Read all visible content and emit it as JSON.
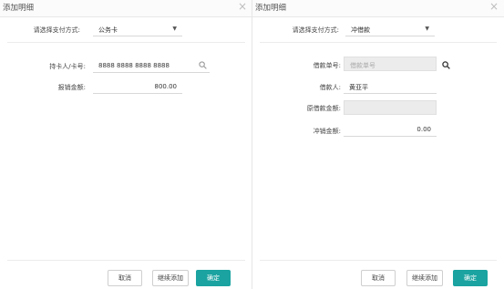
{
  "left": {
    "title": "添加明细",
    "pay_label": "请选择支付方式:",
    "pay_value": "公务卡",
    "card_label": "持卡人/卡号:",
    "card_value": "8888 8888 8888 8888",
    "amount_label": "报销金额:",
    "amount_value": "800.00",
    "buttons": {
      "cancel": "取消",
      "continue": "继续添加",
      "confirm": "确定"
    }
  },
  "right": {
    "title": "添加明细",
    "pay_label": "请选择支付方式:",
    "pay_value": "冲借款",
    "loan_no_label": "借款单号:",
    "loan_no_placeholder": "借款单号",
    "borrower_label": "借款人:",
    "borrower_value": "黄亚平",
    "orig_amount_label": "原借款金额:",
    "orig_amount_value": "",
    "offset_label": "冲销金额:",
    "offset_value": "0.00",
    "buttons": {
      "cancel": "取消",
      "continue": "继续添加",
      "confirm": "确定"
    }
  },
  "icons": {
    "close": "close-icon",
    "search": "search-icon",
    "caret": "chevron-down-icon"
  },
  "colors": {
    "primary": "#1aa3a0",
    "disabled_bg": "#ececec"
  }
}
